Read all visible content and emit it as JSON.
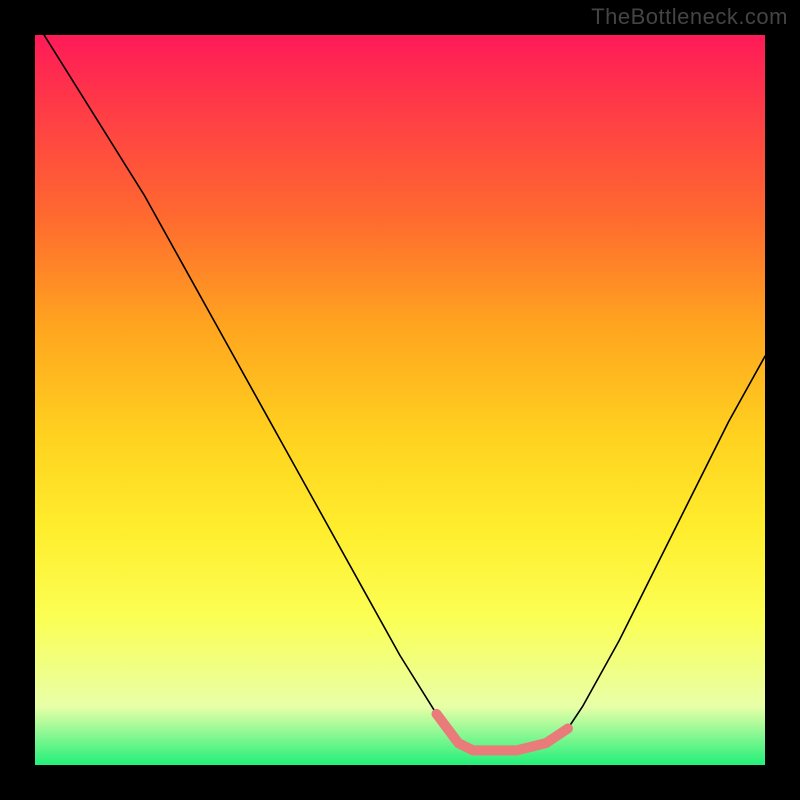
{
  "watermark": "TheBottleneck.com",
  "chart_data": {
    "type": "line",
    "title": "",
    "xlabel": "",
    "ylabel": "",
    "xlim": [
      0,
      100
    ],
    "ylim": [
      0,
      100
    ],
    "series": [
      {
        "name": "bottleneck-curve",
        "x": [
          0,
          5,
          10,
          15,
          20,
          25,
          30,
          35,
          40,
          45,
          50,
          55,
          58,
          60,
          63,
          66,
          70,
          73,
          75,
          80,
          85,
          90,
          95,
          100
        ],
        "values": [
          102,
          94,
          86,
          78,
          69,
          60,
          51,
          42,
          33,
          24,
          15,
          7,
          3,
          2,
          2,
          2,
          3,
          5,
          8,
          17,
          27,
          37,
          47,
          56
        ]
      },
      {
        "name": "highlight-band",
        "x": [
          55,
          58,
          60,
          63,
          66,
          70,
          73
        ],
        "values": [
          7,
          3,
          2,
          2,
          2,
          3,
          5
        ]
      }
    ],
    "colors": {
      "curve": "#000000",
      "highlight": "#e97b7b",
      "gradient_top": "#ff1a58",
      "gradient_bottom": "#22f07a"
    }
  }
}
